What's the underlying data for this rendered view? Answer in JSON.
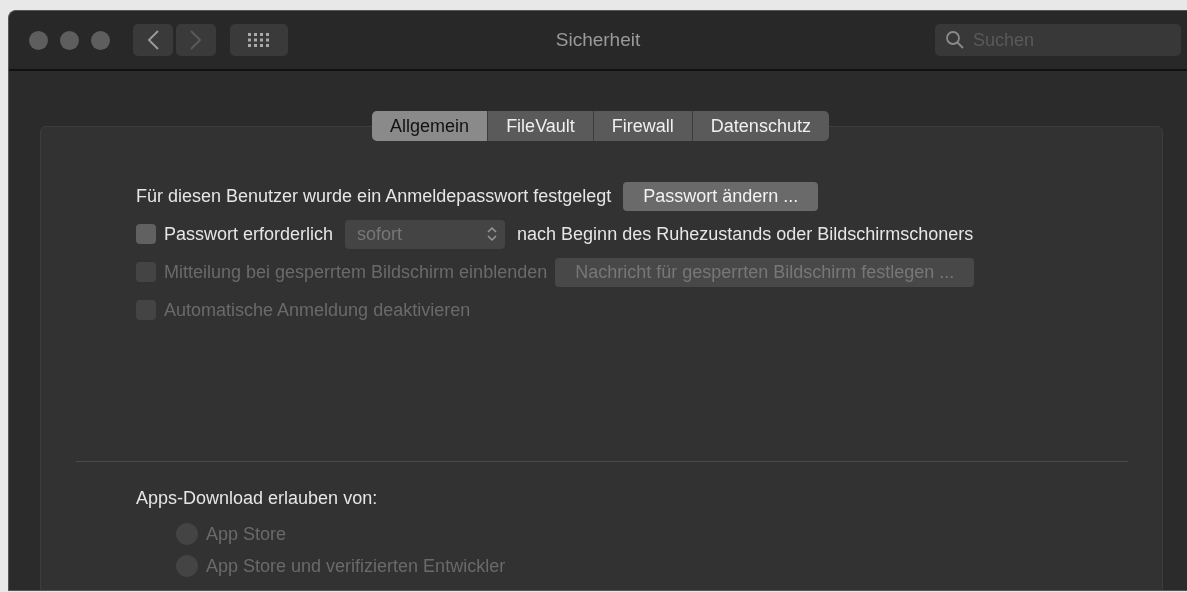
{
  "window": {
    "title": "Sicherheit"
  },
  "search": {
    "placeholder": "Suchen"
  },
  "tabs": [
    {
      "label": "Allgemein",
      "selected": true
    },
    {
      "label": "FileVault",
      "selected": false
    },
    {
      "label": "Firewall",
      "selected": false
    },
    {
      "label": "Datenschutz",
      "selected": false
    }
  ],
  "password_row": {
    "label": "Für diesen Benutzer wurde ein Anmeldepasswort festgelegt",
    "button": "Passwort ändern ..."
  },
  "options": [
    {
      "kind": "delay",
      "label": "Passwort erforderlich",
      "checked": false,
      "disabled": false,
      "select": {
        "value": "sofort",
        "disabled": true
      },
      "suffix": "nach Beginn des Ruhezustands oder Bildschirmschoners"
    },
    {
      "kind": "message",
      "label": "Mitteilung bei gesperrtem Bildschirm einblenden",
      "checked": false,
      "disabled": true,
      "button": {
        "label": "Nachricht für gesperrten Bildschirm festlegen ...",
        "disabled": true
      }
    },
    {
      "kind": "plain",
      "label": "Automatische Anmeldung deaktivieren",
      "checked": false,
      "disabled": true
    }
  ],
  "downloads": {
    "heading": "Apps-Download erlauben von:",
    "choices": [
      {
        "label": "App Store",
        "selected": false,
        "disabled": true
      },
      {
        "label": "App Store und verifizierten Entwickler",
        "selected": false,
        "disabled": true
      }
    ]
  }
}
